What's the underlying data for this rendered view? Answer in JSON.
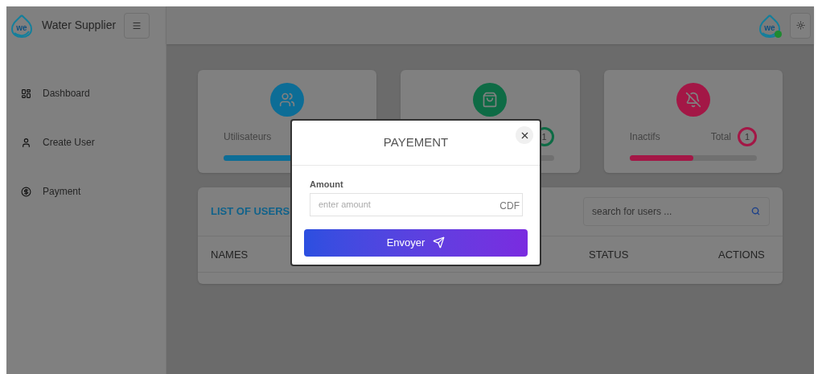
{
  "brand": {
    "logo_text": "we",
    "name": "Water Supplier"
  },
  "sidebar": {
    "items": [
      {
        "kind": "dashboard",
        "label": "Dashboard"
      },
      {
        "kind": "user",
        "label": "Create User"
      },
      {
        "kind": "payment",
        "label": "Payment"
      }
    ]
  },
  "header": {
    "avatar": {
      "logo_text": "we",
      "online": true
    }
  },
  "stat_cards": [
    {
      "kind": "users",
      "color": "#0d6d96",
      "label": "Utilisateurs",
      "level": 1
    },
    {
      "kind": "active",
      "color": "#0e6b45",
      "total": "1"
    },
    {
      "kind": "inactive",
      "color": "#a31746",
      "label": "Inactifs",
      "total_label": "Total",
      "total": "1",
      "level": 0.5
    }
  ],
  "users_table": {
    "title": "LIST OF USERS",
    "search": {
      "placeholder": "search for users ..."
    },
    "columns": [
      {
        "label": "NAMES",
        "kind": "names"
      },
      {
        "label": "STATUS",
        "kind": "status"
      },
      {
        "label": "ACTIONS",
        "kind": "actions"
      }
    ]
  },
  "modal": {
    "title": "PAYEMENT",
    "field": {
      "label": "Amount",
      "placeholder": "enter amount",
      "suffix": "CDF"
    },
    "submit": "Envoyer"
  }
}
